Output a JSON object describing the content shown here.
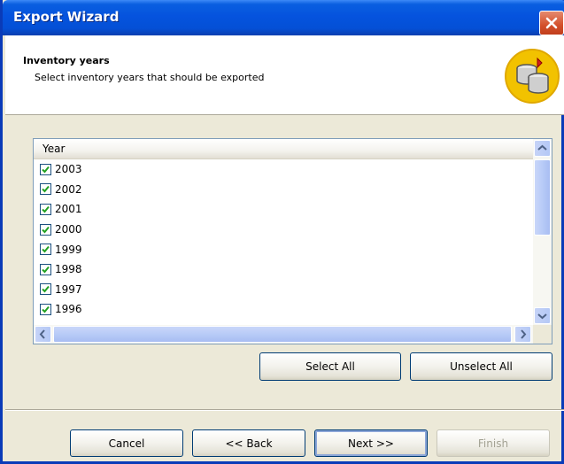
{
  "window": {
    "title": "Export Wizard"
  },
  "header": {
    "title": "Inventory years",
    "subtitle": "Select inventory years that should be exported",
    "icon": "database-export-icon"
  },
  "list": {
    "column_header": "Year",
    "items": [
      {
        "label": "2003",
        "checked": true
      },
      {
        "label": "2002",
        "checked": true
      },
      {
        "label": "2001",
        "checked": true
      },
      {
        "label": "2000",
        "checked": true
      },
      {
        "label": "1999",
        "checked": true
      },
      {
        "label": "1998",
        "checked": true
      },
      {
        "label": "1997",
        "checked": true
      },
      {
        "label": "1996",
        "checked": true
      }
    ]
  },
  "actions": {
    "select_all": "Select All",
    "unselect_all": "Unselect All"
  },
  "footer": {
    "cancel": "Cancel",
    "back": "<< Back",
    "next": "Next >>",
    "finish": "Finish"
  },
  "colors": {
    "titlebar": "#0553de",
    "dialog": "#ece9d8",
    "close": "#d4502b"
  }
}
